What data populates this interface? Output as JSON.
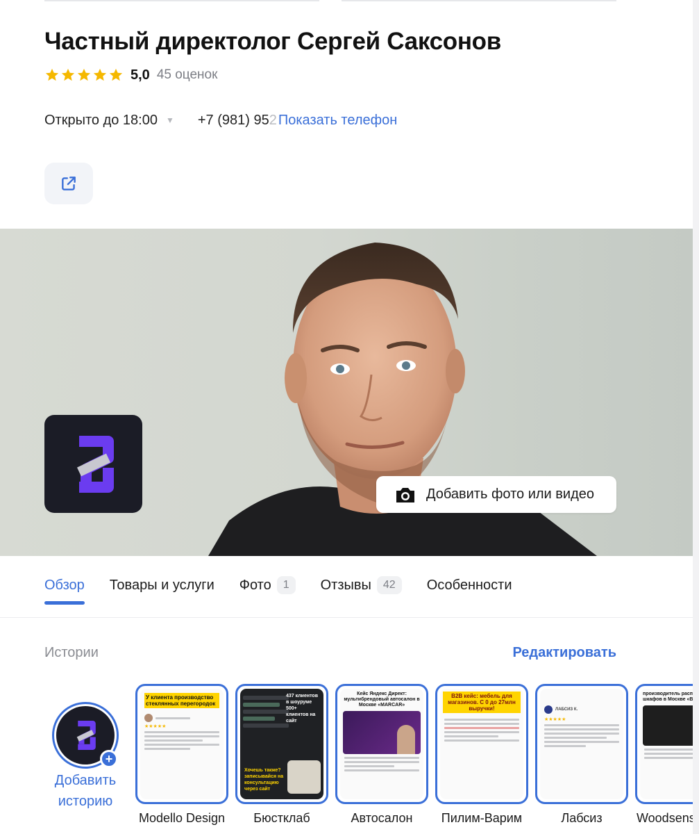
{
  "business": {
    "name": "Частный директолог Сергей Саксонов",
    "rating_value": "5,0",
    "rating_stars": 5,
    "rating_count": "45 оценок",
    "hours": "Открыто до 18:00",
    "phone_visible": "+7 (981) 95",
    "phone_faded": "2",
    "show_phone": "Показать телефон"
  },
  "hero": {
    "add_media_label": "Добавить фото или видео"
  },
  "tabs": [
    {
      "label": "Обзор",
      "badge": null
    },
    {
      "label": "Товары и услуги",
      "badge": null
    },
    {
      "label": "Фото",
      "badge": "1"
    },
    {
      "label": "Отзывы",
      "badge": "42"
    },
    {
      "label": "Особенности",
      "badge": null
    }
  ],
  "stories": {
    "label": "Истории",
    "edit_label": "Редактировать",
    "add_label": "Добавить историю",
    "items": [
      {
        "label": "Modello Design",
        "headline": "У клиента производство стеклянных перегородок"
      },
      {
        "label": "Бюстклаб",
        "headline": "437 клиентов в шоуруме 500+ клиентов на сайт",
        "cta": "Хочешь также? записывайся на консультацию через сайт"
      },
      {
        "label": "Автосалон",
        "headline": "Кейс Яндекс Директ: мультибрендовый автосалон в Москве «MARCAR»"
      },
      {
        "label": "Пилим-Варим",
        "headline": "B2B кейс: мебель для магазинов. С 0 до 27млн выручки!"
      },
      {
        "label": "Лабсиз",
        "headline": "ЛАБСИЗ К."
      },
      {
        "label": "Woodsense",
        "headline": "производитель распашных шкафов в Москве «В»"
      }
    ]
  },
  "colors": {
    "accent": "#3a6fd8",
    "star": "#f5b800",
    "logo_bg": "#1b1c26",
    "logo_purple": "#6b3cf0"
  },
  "icons": {
    "share": "external-link-icon",
    "camera": "camera-icon",
    "star": "star-icon",
    "caret": "caret-down-icon",
    "plus": "plus-icon"
  }
}
